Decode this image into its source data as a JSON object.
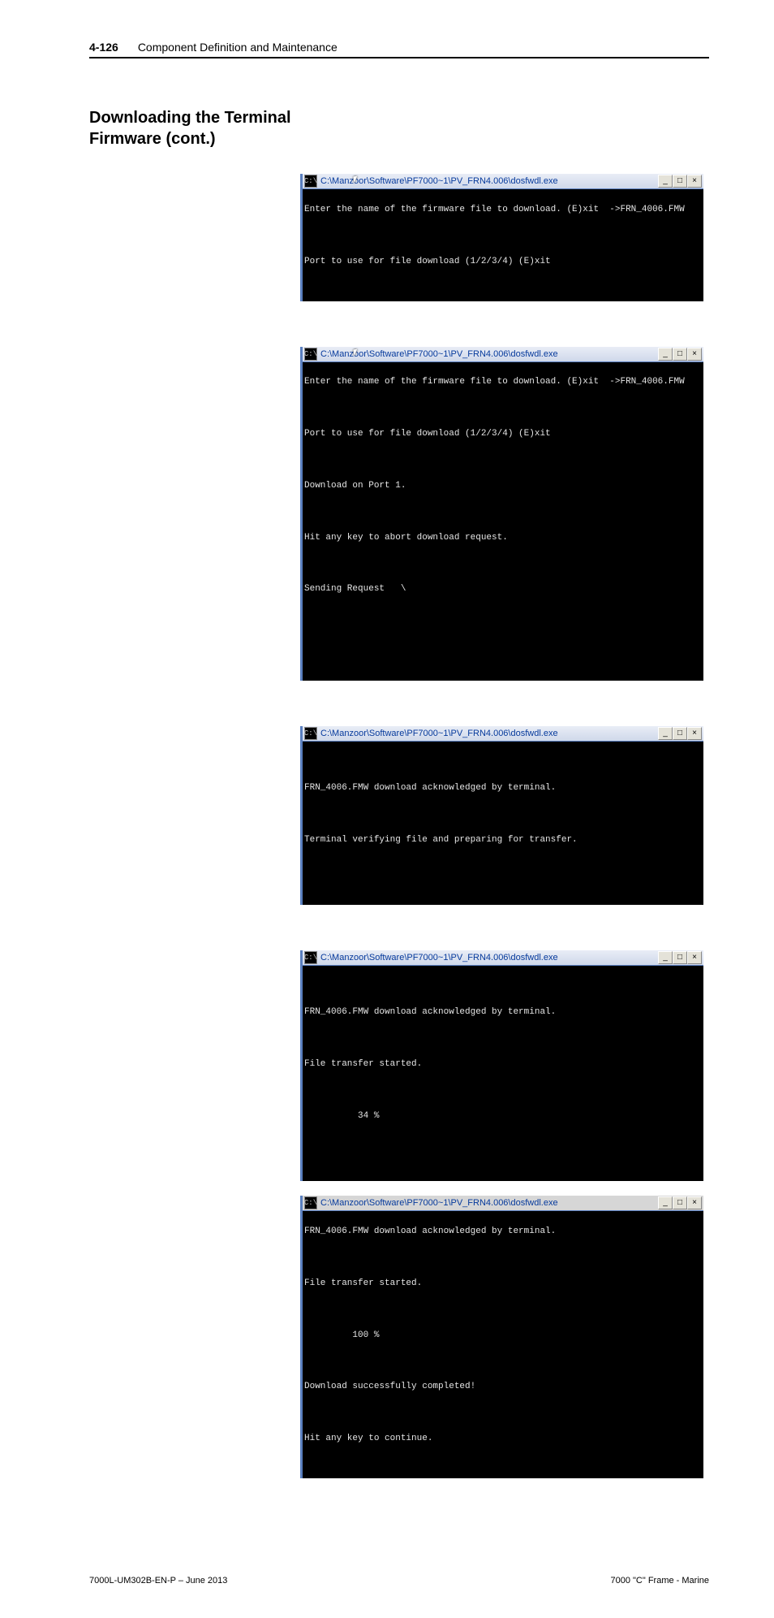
{
  "header": {
    "page_number": "4-126",
    "doc_title": "Component Definition and Maintenance"
  },
  "section_heading": {
    "line1": "Downloading the Terminal",
    "line2": "Firmware (cont.)"
  },
  "win": {
    "title": "C:\\Manzoor\\Software\\PF7000~1\\PV_FRN4.006\\dosfwdl.exe",
    "icon_glyph": "C:\\",
    "min": "_",
    "max": "□",
    "close": "×"
  },
  "fig1": {
    "l1": "Enter the name of the firmware file to download. (E)xit  ->FRN_4006.FMW",
    "l2": " ",
    "l3": "Port to use for file download (1/2/3/4) (E)xit"
  },
  "fig2": {
    "l1": "Enter the name of the firmware file to download. (E)xit  ->FRN_4006.FMW",
    "l2": " ",
    "l3": "Port to use for file download (1/2/3/4) (E)xit",
    "l4": " ",
    "l5": "Download on Port 1.",
    "l6": " ",
    "l7": "Hit any key to abort download request.",
    "l8": " ",
    "l9": "Sending Request   \\"
  },
  "fig3": {
    "l1": "FRN_4006.FMW download acknowledged by terminal.",
    "l2": " ",
    "l3": "Terminal verifying file and preparing for transfer."
  },
  "fig4": {
    "l1": "FRN_4006.FMW download acknowledged by terminal.",
    "l2": " ",
    "l3": "File transfer started.",
    "l4": " ",
    "l5": "          34 %"
  },
  "fig5": {
    "l1": "FRN_4006.FMW download acknowledged by terminal.",
    "l2": " ",
    "l3": "File transfer started.",
    "l4": " ",
    "l5": "         100 %",
    "l6": " ",
    "l7": "Download successfully completed!",
    "l8": " ",
    "l9": "Hit any key to continue."
  },
  "footer": {
    "left": "7000L-UM302B-EN-P – June 2013",
    "right": "7000 \"C\" Frame - Marine"
  }
}
